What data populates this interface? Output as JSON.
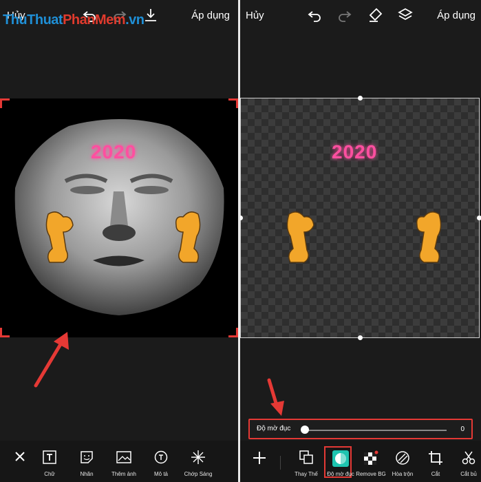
{
  "watermark": {
    "part1": "ThuThuat",
    "part2": "PhanMem",
    "part3": ".vn"
  },
  "left": {
    "cancel_label": "Hủy",
    "apply_label": "Áp dụng",
    "sticker_text": "2020",
    "tools": [
      {
        "label": "Chữ",
        "icon": "text-icon"
      },
      {
        "label": "Nhãn",
        "icon": "sticker-icon"
      },
      {
        "label": "Thêm ảnh",
        "icon": "add-image-icon"
      },
      {
        "label": "Mô tả",
        "icon": "description-icon"
      },
      {
        "label": "Chớp Sáng",
        "icon": "flash-icon"
      }
    ]
  },
  "right": {
    "cancel_label": "Hủy",
    "apply_label": "Áp dụng",
    "sticker_text": "2020",
    "opacity": {
      "label": "Độ mờ đục",
      "value": "0",
      "level": 0
    },
    "tools": [
      {
        "label": "Thay Thế",
        "icon": "replace-icon"
      },
      {
        "label": "Độ mờ đục",
        "icon": "opacity-icon"
      },
      {
        "label": "Remove BG",
        "icon": "remove-bg-icon"
      },
      {
        "label": "Hòa trộn",
        "icon": "blend-icon"
      },
      {
        "label": "Cắt",
        "icon": "crop-icon"
      },
      {
        "label": "Cắt bủ",
        "icon": "cutout-icon"
      }
    ]
  },
  "colors": {
    "accent_red": "#e53935",
    "neon_pink": "#ff4fa0",
    "neon_green": "#8cff3a",
    "tiger_orange": "#f2a62a"
  }
}
